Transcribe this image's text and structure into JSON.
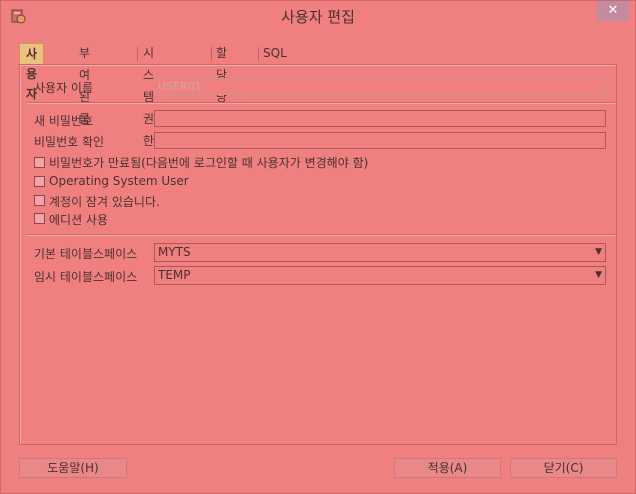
{
  "window": {
    "title": "사용자 편집",
    "close_label": "✕"
  },
  "tabs": [
    "사용자",
    "부여된 롤",
    "시스템 권한",
    "할당량",
    "SQL"
  ],
  "form": {
    "username_label": "사용자 이름",
    "username_value": "USER01",
    "new_password_label": "새 비밀번호",
    "confirm_password_label": "비밀번호 확인",
    "checkboxes": [
      "비밀번호가 만료됨(다음번에 로그인할 때 사용자가 변경해야 함)",
      "Operating System User",
      "계정이 잠겨 있습니다.",
      "에디션 사용"
    ],
    "default_tablespace_label": "기본 테이블스페이스",
    "default_tablespace_value": "MYTS",
    "temp_tablespace_label": "임시 테이블스페이스",
    "temp_tablespace_value": "TEMP"
  },
  "buttons": {
    "help": "도움말(H)",
    "apply": "적용(A)",
    "close": "닫기(C)"
  }
}
